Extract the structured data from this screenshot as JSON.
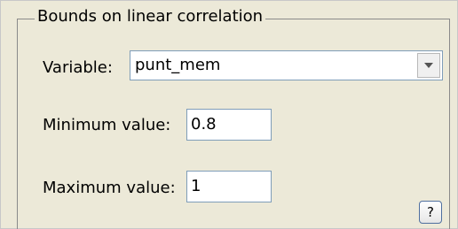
{
  "group": {
    "title": "Bounds on linear correlation"
  },
  "variable": {
    "label": "Variable:",
    "selected": "punt_mem"
  },
  "minimum": {
    "label": "Minimum value:",
    "value": "0.8"
  },
  "maximum": {
    "label": "Maximum value:",
    "value": "1"
  },
  "help": {
    "label": "?"
  }
}
